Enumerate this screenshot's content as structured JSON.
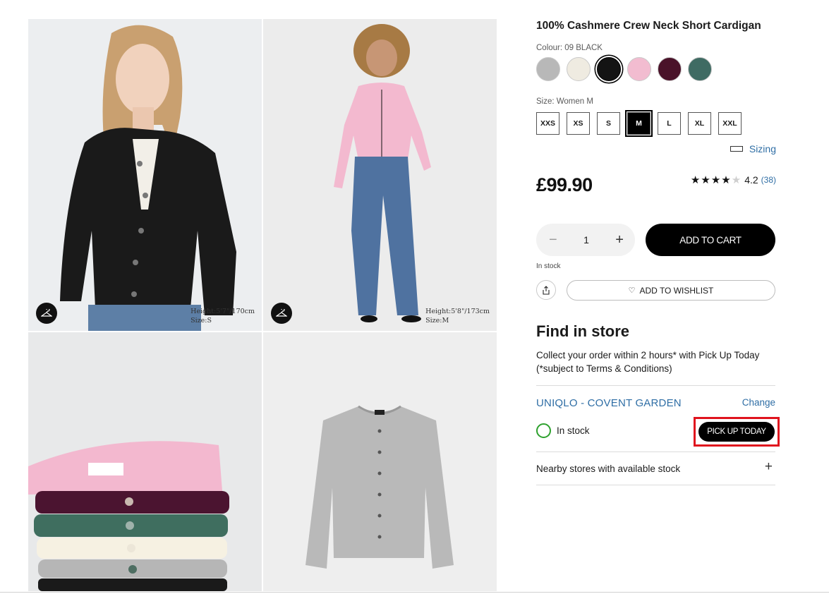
{
  "gallery": {
    "image1": {
      "model_height": "Height:5'7\"/170cm",
      "model_size": "Size:S"
    },
    "image2": {
      "model_height": "Height:5'8\"/173cm",
      "model_size": "Size:M"
    }
  },
  "product": {
    "title": "100% Cashmere Crew Neck Short Cardigan",
    "colour_label": "Colour: 09 BLACK",
    "swatches": [
      {
        "name": "grey",
        "color": "#b8b8b8"
      },
      {
        "name": "off-white",
        "color": "#efebe1"
      },
      {
        "name": "black",
        "color": "#141414",
        "selected": true
      },
      {
        "name": "pink",
        "color": "#f2bcd0"
      },
      {
        "name": "wine",
        "color": "#4a1229"
      },
      {
        "name": "green",
        "color": "#3f6b63"
      }
    ],
    "size_label": "Size: Women M",
    "sizes": [
      "XXS",
      "XS",
      "S",
      "M",
      "L",
      "XL",
      "XXL"
    ],
    "selected_size": "M",
    "sizing_link": "Sizing",
    "price": "£99.90",
    "rating": {
      "stars_filled": 4,
      "value": "4.2",
      "count": "(38)"
    },
    "quantity": "1",
    "add_to_cart": "ADD TO CART",
    "stock_status": "In stock",
    "wishlist": "ADD TO WISHLIST"
  },
  "store": {
    "heading": "Find in store",
    "collect_line1": "Collect your order within 2 hours* with Pick Up Today",
    "collect_line2": "(*subject to Terms & Conditions)",
    "name": "UNIQLO - COVENT GARDEN",
    "change": "Change",
    "stock": "In stock",
    "pickup_button": "PICK UP TODAY",
    "nearby": "Nearby stores with available stock",
    "expand": "+"
  },
  "colors": {
    "accent_link": "#2f6ea5",
    "in_stock": "#2ea12e",
    "highlight": "#e0141e"
  }
}
